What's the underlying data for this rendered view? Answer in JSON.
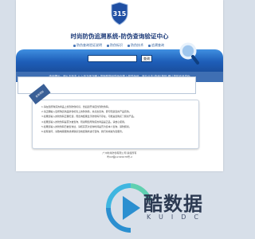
{
  "shield": {
    "text": "315",
    "color": "#1f4fa3"
  },
  "site_title": "时尚防伪追溯系统-防伪查询验证中心",
  "nav": [
    {
      "label": "防伪查询验证说明"
    },
    {
      "label": "防伪标识"
    },
    {
      "label": "防伪技术"
    },
    {
      "label": "追溯查询"
    }
  ],
  "search": {
    "value": "",
    "placeholder": "",
    "button_label": "查询"
  },
  "tips_text": "查询提示：请从左至右,从上至下依次输入您所购物品防伪标签上的防伪码，然后点击\"查询\"按钮,确认您的产品真伪",
  "info": {
    "ribbon_label": "查询须知",
    "lines": [
      "1.请在您所购买的商品上找到防伪标识，然后刮开涂层找到防伪码。",
      "2.请正确输入您所购买商品防伪标签上的防伪码，并点击查询，即可知道您的产品真伪。",
      "3.如果您输入的防伪码正确无误，而查询结果显示防伪码不存在，可能是您购买了假冒产品。",
      "4.如果您输入的防伪码是首次被查询，则说明您所购买的商品是正品，请放心使用。",
      "5.如果您输入的防伪码已被查询过，请核实首次查询时间是否为您本人查询，谨防假冒。",
      "6.如有疑问，请致电客服热线或联系当地经销商进行咨询，我们将竭诚为您服务。"
    ]
  },
  "footer": {
    "line1": "广州时尚防伪有限公司 版权所有",
    "line2": "粤ICP备12345678号-2"
  },
  "watermark": {
    "main": "酷数据",
    "sub": "KUIDC"
  },
  "colors": {
    "banner_top": "#3f8fe0",
    "banner_bottom": "#1a4f9e",
    "tips_bar": "#3f6fb3",
    "title": "#1e3c7a"
  }
}
